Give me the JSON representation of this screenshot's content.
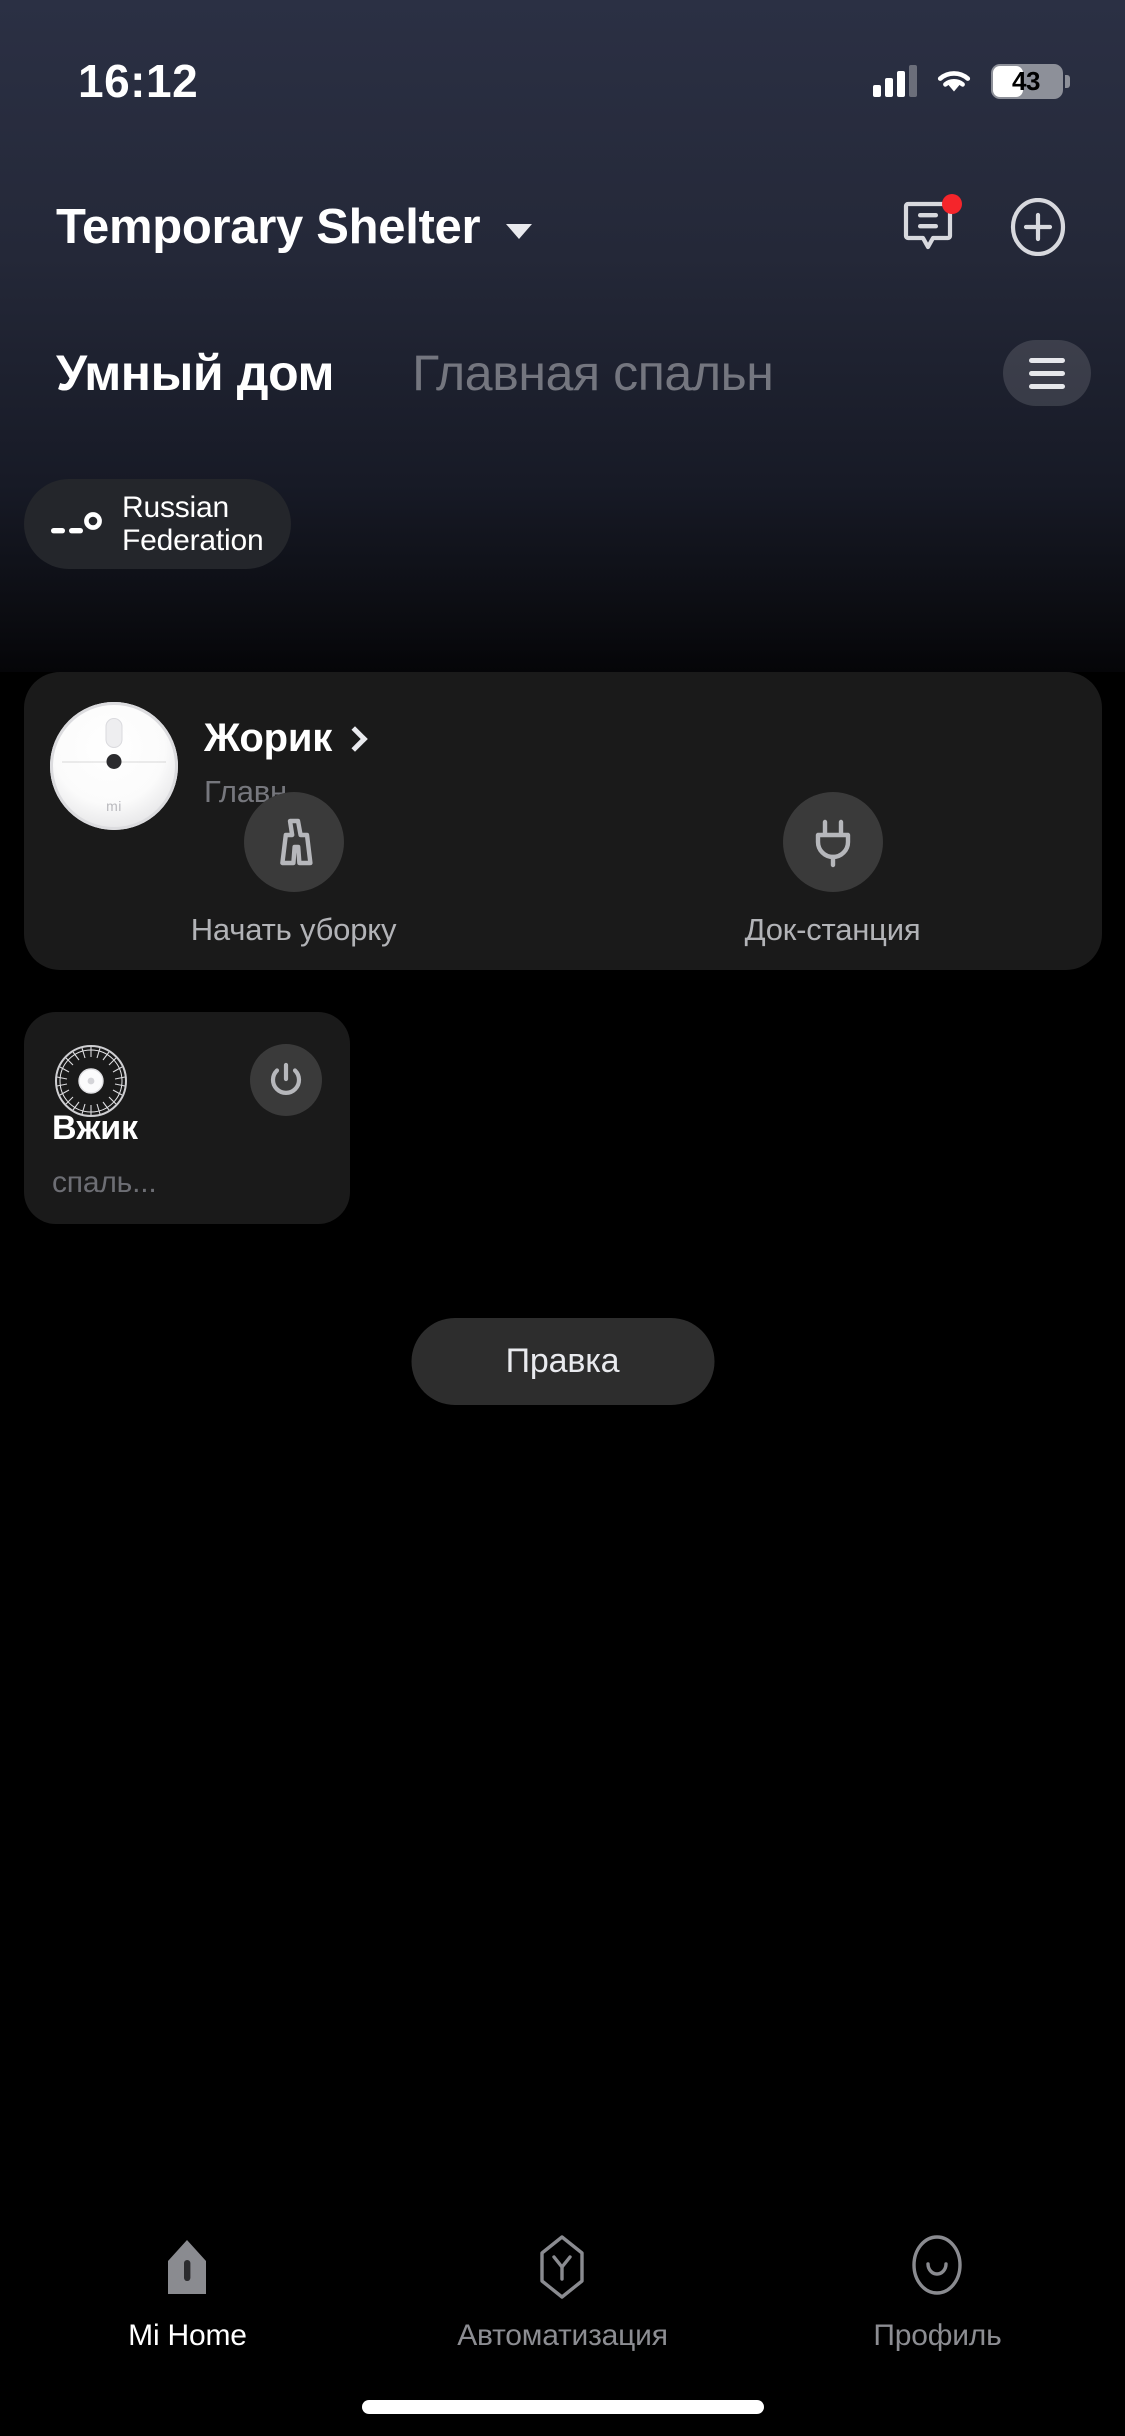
{
  "status_bar": {
    "time": "16:12",
    "battery_level": "43",
    "battery_percent": 43,
    "signal_icon": "cellular-signal-icon",
    "wifi_icon": "wifi-icon",
    "battery_icon": "battery-icon"
  },
  "header": {
    "home_name": "Temporary Shelter",
    "dropdown_icon": "chevron-down-icon",
    "messages_icon": "message-bubble-icon",
    "messages_badge": true,
    "add_icon": "plus-circle-icon"
  },
  "tabs": {
    "items": [
      {
        "label": "Умный дом",
        "active": true
      },
      {
        "label": "Главная спальн",
        "active": false
      }
    ],
    "menu_icon": "hamburger-menu-icon"
  },
  "weather_chip": {
    "icon": "temperature-dashes-icon",
    "text": "Russian\nFederation"
  },
  "devices": [
    {
      "id": "vacuum",
      "name": "Жорик",
      "room": "Главн...",
      "image_icon": "robot-vacuum-icon",
      "brand_mark": "mi",
      "chevron_icon": "chevron-right-icon",
      "actions": [
        {
          "label": "Начать уборку",
          "icon": "broom-icon"
        },
        {
          "label": "Док-станция",
          "icon": "power-plug-icon"
        }
      ]
    },
    {
      "id": "fan",
      "name": "Вжик",
      "room": "спаль...",
      "image_icon": "fan-icon",
      "power_icon": "power-icon"
    }
  ],
  "edit_button": {
    "label": "Правка"
  },
  "bottom_nav": {
    "items": [
      {
        "label": "Mi Home",
        "icon": "home-icon",
        "active": true
      },
      {
        "label": "Автоматизация",
        "icon": "automation-hex-icon",
        "active": false
      },
      {
        "label": "Профиль",
        "icon": "profile-smile-icon",
        "active": false
      }
    ]
  },
  "colors": {
    "accent_badge": "#f5252b",
    "card_bg": "#1a1a1a",
    "page_bg": "#000000",
    "header_gradient_top": "#2b3044"
  }
}
